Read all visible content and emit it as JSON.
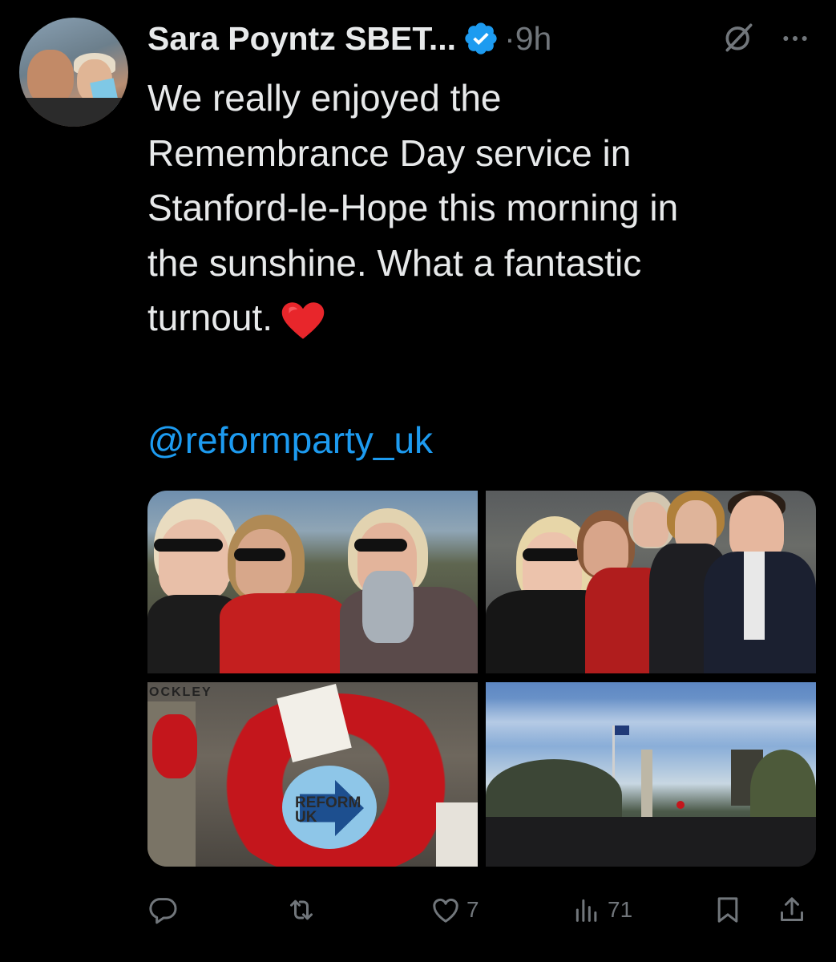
{
  "tweet": {
    "author_name": "Sara Poyntz SBET...",
    "time": "·9h",
    "text": "We really enjoyed the\nRemembrance Day service in\nStanford-le-Hope this morning in\nthe sunshine. What a fantastic\nturnout.",
    "mention": "@reformparty_uk",
    "verified": true
  },
  "media": {
    "photo_count": 4,
    "wreath_sign": "REFORM\nUK",
    "stone_text": "OCKLEY"
  },
  "actions": {
    "reply_icon": "reply-icon",
    "retweet_icon": "retweet-icon",
    "like_count": "7",
    "views_count": "71",
    "bookmark_icon": "bookmark-icon",
    "share_icon": "share-icon"
  },
  "colors": {
    "background": "#000000",
    "text": "#e7e9ea",
    "muted": "#71767b",
    "link": "#1d9bf0",
    "verified": "#1d9bf0"
  }
}
